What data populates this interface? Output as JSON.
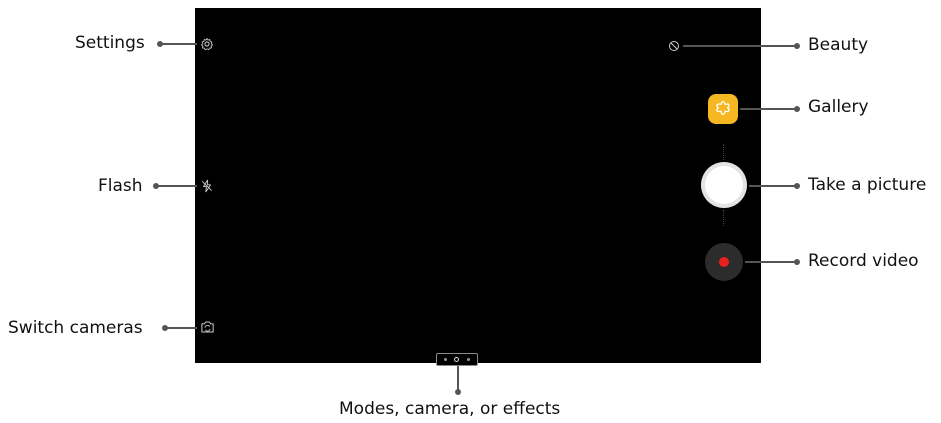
{
  "callouts": {
    "settings": "Settings",
    "flash": "Flash",
    "switch_cameras": "Switch cameras",
    "beauty": "Beauty",
    "gallery": "Gallery",
    "take_picture": "Take a picture",
    "record_video": "Record video",
    "modes": "Modes, camera, or effects"
  },
  "colors": {
    "viewfinder_bg": "#000000",
    "gallery_accent": "#f5b823",
    "record_red": "#e8211e",
    "leader_line": "#555555"
  },
  "icons": {
    "settings": "gear-icon",
    "flash": "flash-off-icon",
    "switch_cameras": "camera-switch-icon",
    "beauty": "beauty-icon",
    "gallery": "gallery-icon"
  }
}
